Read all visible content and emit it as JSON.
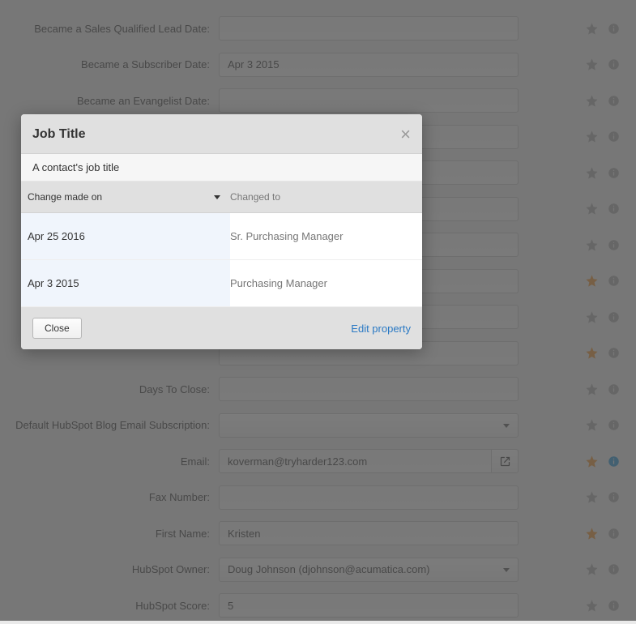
{
  "form": {
    "rows": [
      {
        "label": "",
        "value": "",
        "type": "text",
        "star": false,
        "info": false,
        "half": true
      },
      {
        "label": "Became a Sales Qualified Lead Date:",
        "value": "",
        "type": "text",
        "star": false,
        "info": false
      },
      {
        "label": "Became a Subscriber Date:",
        "value": "Apr 3 2015",
        "type": "text",
        "star": false,
        "info": false
      },
      {
        "label": "Became an Evangelist Date:",
        "value": "",
        "type": "text",
        "star": false,
        "info": false
      },
      {
        "label": "",
        "value": "",
        "type": "text",
        "star": false,
        "info": false,
        "hidden": true
      },
      {
        "label": "",
        "value": "",
        "type": "text",
        "star": false,
        "info": false,
        "hidden": true
      },
      {
        "label": "",
        "value": "",
        "type": "text",
        "star": false,
        "info": false,
        "hidden": true
      },
      {
        "label": "",
        "value": "",
        "type": "text",
        "star": false,
        "info": false,
        "hidden": true
      },
      {
        "label": "",
        "value": "",
        "type": "text",
        "star": true,
        "info": false,
        "hidden": true
      },
      {
        "label": "",
        "value": "",
        "type": "text",
        "star": false,
        "info": false,
        "hidden": true
      },
      {
        "label": "",
        "value": "",
        "type": "text",
        "star": true,
        "info": false,
        "hidden": true
      },
      {
        "label": "Days To Close:",
        "value": "",
        "type": "text",
        "star": false,
        "info": false
      },
      {
        "label": "Default HubSpot Blog Email Subscription:",
        "value": "",
        "type": "select",
        "star": false,
        "info": false
      },
      {
        "label": "Email:",
        "value": "koverman@tryharder123.com",
        "type": "email",
        "star": true,
        "info": true
      },
      {
        "label": "Fax Number:",
        "value": "",
        "type": "text",
        "star": false,
        "info": false
      },
      {
        "label": "First Name:",
        "value": "Kristen",
        "type": "text",
        "star": true,
        "info": false
      },
      {
        "label": "HubSpot Owner:",
        "value": "Doug Johnson (djohnson@acumatica.com)",
        "type": "select",
        "star": false,
        "info": false
      },
      {
        "label": "HubSpot Score:",
        "value": "5",
        "type": "text",
        "star": false,
        "info": false
      }
    ]
  },
  "modal": {
    "title": "Job Title",
    "description": "A contact's job title",
    "columns": {
      "date": "Change made on",
      "value": "Changed to"
    },
    "history": [
      {
        "date": "Apr 25 2016",
        "value": "Sr. Purchasing Manager"
      },
      {
        "date": "Apr 3 2015",
        "value": "Purchasing Manager"
      }
    ],
    "close_label": "Close",
    "edit_label": "Edit property"
  }
}
